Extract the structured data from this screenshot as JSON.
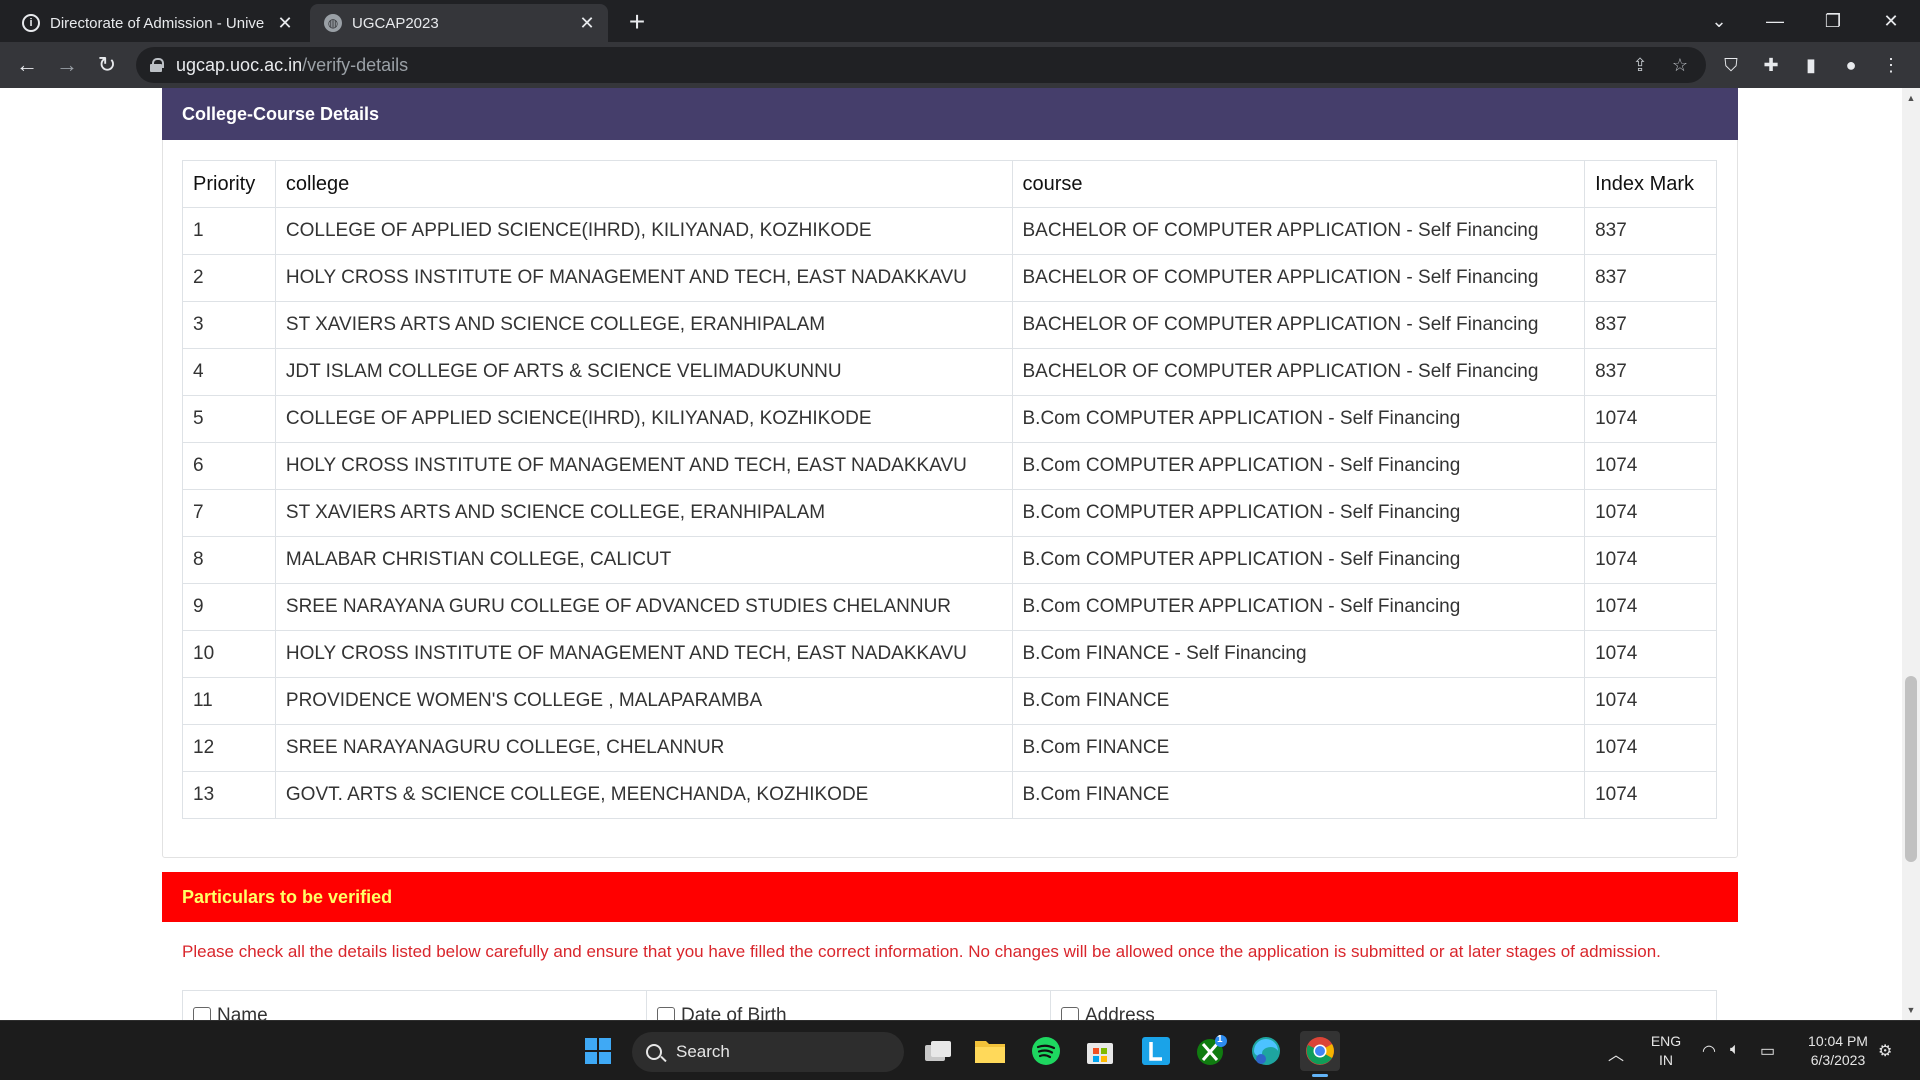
{
  "browser": {
    "tabs": [
      {
        "title": "Directorate of Admission - Unive",
        "favicon": "info-icon",
        "favicon_glyph": "i"
      },
      {
        "title": "UGCAP2023",
        "favicon": "globe-icon",
        "favicon_glyph": "◍"
      }
    ],
    "url_host": "ugcap.uoc.ac.in",
    "url_path": "/verify-details"
  },
  "college_course": {
    "header": "College-Course Details",
    "columns": [
      "Priority",
      "college",
      "course",
      "Index Mark"
    ],
    "rows": [
      [
        "1",
        "COLLEGE OF APPLIED SCIENCE(IHRD), KILIYANAD, KOZHIKODE",
        "BACHELOR OF COMPUTER APPLICATION - Self Financing",
        "837"
      ],
      [
        "2",
        "HOLY CROSS INSTITUTE OF MANAGEMENT AND TECH, EAST NADAKKAVU",
        "BACHELOR OF COMPUTER APPLICATION - Self Financing",
        "837"
      ],
      [
        "3",
        "ST XAVIERS ARTS AND SCIENCE COLLEGE, ERANHIPALAM",
        "BACHELOR OF COMPUTER APPLICATION - Self Financing",
        "837"
      ],
      [
        "4",
        "JDT ISLAM COLLEGE OF ARTS & SCIENCE VELIMADUKUNNU",
        "BACHELOR OF COMPUTER APPLICATION - Self Financing",
        "837"
      ],
      [
        "5",
        "COLLEGE OF APPLIED SCIENCE(IHRD), KILIYANAD, KOZHIKODE",
        "B.Com COMPUTER APPLICATION - Self Financing",
        "1074"
      ],
      [
        "6",
        "HOLY CROSS INSTITUTE OF MANAGEMENT AND TECH, EAST NADAKKAVU",
        "B.Com COMPUTER APPLICATION - Self Financing",
        "1074"
      ],
      [
        "7",
        "ST XAVIERS ARTS AND SCIENCE COLLEGE, ERANHIPALAM",
        "B.Com COMPUTER APPLICATION - Self Financing",
        "1074"
      ],
      [
        "8",
        "MALABAR CHRISTIAN COLLEGE, CALICUT",
        "B.Com COMPUTER APPLICATION - Self Financing",
        "1074"
      ],
      [
        "9",
        "SREE NARAYANA GURU COLLEGE OF ADVANCED STUDIES CHELANNUR",
        "B.Com COMPUTER APPLICATION - Self Financing",
        "1074"
      ],
      [
        "10",
        "HOLY CROSS INSTITUTE OF MANAGEMENT AND TECH, EAST NADAKKAVU",
        "B.Com FINANCE - Self Financing",
        "1074"
      ],
      [
        "11",
        "PROVIDENCE WOMEN'S COLLEGE , MALAPARAMBA",
        "B.Com FINANCE",
        "1074"
      ],
      [
        "12",
        "SREE NARAYANAGURU COLLEGE, CHELANNUR",
        "B.Com FINANCE",
        "1074"
      ],
      [
        "13",
        "GOVT. ARTS & SCIENCE COLLEGE, MEENCHANDA, KOZHIKODE",
        "B.Com FINANCE",
        "1074"
      ]
    ]
  },
  "verify": {
    "header": "Particulars to be verified",
    "note": "Please check all the details listed below carefully and ensure that you have filled the correct information. No changes will be allowed once the application is submitted or at later stages of admission.",
    "items": [
      "Name",
      "Date of Birth",
      "Address"
    ]
  },
  "taskbar": {
    "search_label": "Search",
    "lang_line1": "ENG",
    "lang_line2": "IN",
    "time": "10:04 PM",
    "date": "6/3/2023",
    "xbox_badge": "1"
  },
  "colors": {
    "card_header": "#453e6b",
    "verify_header": "#ff0000",
    "verify_header_text": "#ffff66",
    "verify_note": "#d9262c"
  }
}
